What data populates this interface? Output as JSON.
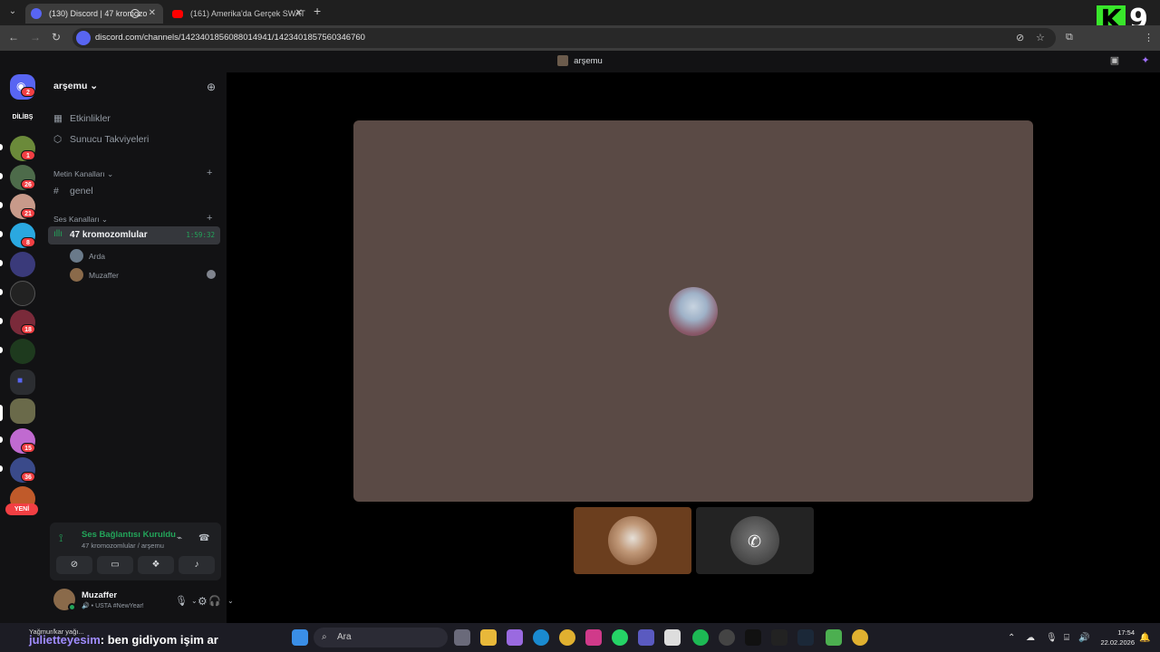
{
  "browser": {
    "tabs": [
      {
        "title": "(130) Discord | 47 kromozo"
      },
      {
        "title": "(161) Amerika'da Gerçek SWAT"
      }
    ],
    "url": "discord.com/channels/1423401856088014941/1423401857560346760",
    "overlay_logo": {
      "letter": "K",
      "number": "9"
    }
  },
  "discord": {
    "window_title": "arşemu",
    "rail": {
      "badges": [
        "2",
        "1",
        "26",
        "21",
        "8",
        "18",
        "15",
        "36"
      ],
      "dilibs_label": "DİLİBŞ",
      "new_label": "YENİ"
    },
    "server": {
      "name": "arşemu",
      "nav": [
        "Etkinlikler",
        "Sunucu Takviyeleri"
      ],
      "text_category": "Metin Kanalları",
      "text_channel": "genel",
      "voice_category": "Ses Kanalları",
      "voice_channel": "47 kromozomlular",
      "voice_timer": "1:59:32",
      "voice_users": [
        "Arda",
        "Muzaffer"
      ]
    },
    "voice_panel": {
      "status": "Ses Bağlantısı Kuruldu",
      "location": "47 kromozomlular / arşemu"
    },
    "user": {
      "name": "Muzaffer",
      "status": "USTA #NewYear!"
    }
  },
  "taskbar": {
    "weather": "Yağmur/kar yağı...",
    "chat_user": "julietteyesim",
    "chat_message": ": ben gidiyom işim ar",
    "search_placeholder": "Ara",
    "time": "17:54",
    "date": "22.02.2026"
  },
  "colors": {
    "stage": "#5a4a45",
    "accent_green": "#23a55a",
    "badge_red": "#f23f43",
    "blurple": "#5865f2"
  }
}
